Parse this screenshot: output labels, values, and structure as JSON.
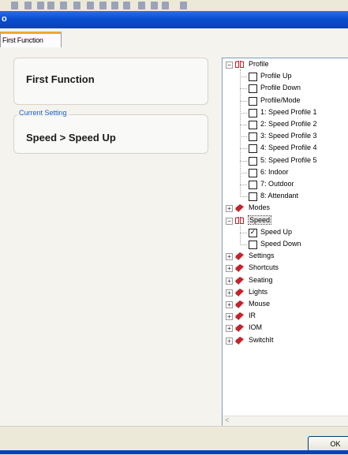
{
  "window": {
    "title": "o"
  },
  "tabs": [
    {
      "label": "First Function",
      "active": true
    }
  ],
  "function_box": {
    "title": "First Function"
  },
  "current_setting": {
    "legend": "Current Setting",
    "value": "Speed > Speed Up"
  },
  "tree": {
    "nodes": [
      {
        "label": "Profile",
        "kind": "folder-open",
        "expanded": true,
        "level": 0
      },
      {
        "label": "Profile Up",
        "kind": "check",
        "checked": false,
        "level": 1
      },
      {
        "label": "Profile Down",
        "kind": "check",
        "checked": false,
        "level": 1
      },
      {
        "label": "Profile/Mode",
        "kind": "check",
        "checked": false,
        "level": 1
      },
      {
        "label": "1: Speed Profile 1",
        "kind": "check",
        "checked": false,
        "level": 1
      },
      {
        "label": "2: Speed Profile 2",
        "kind": "check",
        "checked": false,
        "level": 1
      },
      {
        "label": "3: Speed Profile 3",
        "kind": "check",
        "checked": false,
        "level": 1
      },
      {
        "label": "4: Speed Profile 4",
        "kind": "check",
        "checked": false,
        "level": 1
      },
      {
        "label": "5: Speed Profile 5",
        "kind": "check",
        "checked": false,
        "level": 1
      },
      {
        "label": "6: Indoor",
        "kind": "check",
        "checked": false,
        "level": 1
      },
      {
        "label": "7: Outdoor",
        "kind": "check",
        "checked": false,
        "level": 1
      },
      {
        "label": "8: Attendant",
        "kind": "check",
        "checked": false,
        "level": 1
      },
      {
        "label": "Modes",
        "kind": "folder-closed",
        "expanded": false,
        "level": 0
      },
      {
        "label": "Speed",
        "kind": "folder-open",
        "expanded": true,
        "level": 0,
        "selected": true
      },
      {
        "label": "Speed Up",
        "kind": "check",
        "checked": true,
        "level": 1
      },
      {
        "label": "Speed Down",
        "kind": "check",
        "checked": false,
        "level": 1
      },
      {
        "label": "Settings",
        "kind": "folder-closed",
        "expanded": false,
        "level": 0
      },
      {
        "label": "Shortcuts",
        "kind": "folder-closed",
        "expanded": false,
        "level": 0
      },
      {
        "label": "Seating",
        "kind": "folder-closed",
        "expanded": false,
        "level": 0
      },
      {
        "label": "Lights",
        "kind": "folder-closed",
        "expanded": false,
        "level": 0
      },
      {
        "label": "Mouse",
        "kind": "folder-closed",
        "expanded": false,
        "level": 0
      },
      {
        "label": "IR",
        "kind": "folder-closed",
        "expanded": false,
        "level": 0
      },
      {
        "label": "IOM",
        "kind": "folder-closed",
        "expanded": false,
        "level": 0
      },
      {
        "label": "SwitchIt",
        "kind": "folder-closed",
        "expanded": false,
        "level": 0
      }
    ]
  },
  "footer": {
    "ok_label": "OK"
  },
  "colors": {
    "accent": "#0a4fd0",
    "tab_highlight": "#f0a830",
    "book_red": "#c8202a"
  }
}
